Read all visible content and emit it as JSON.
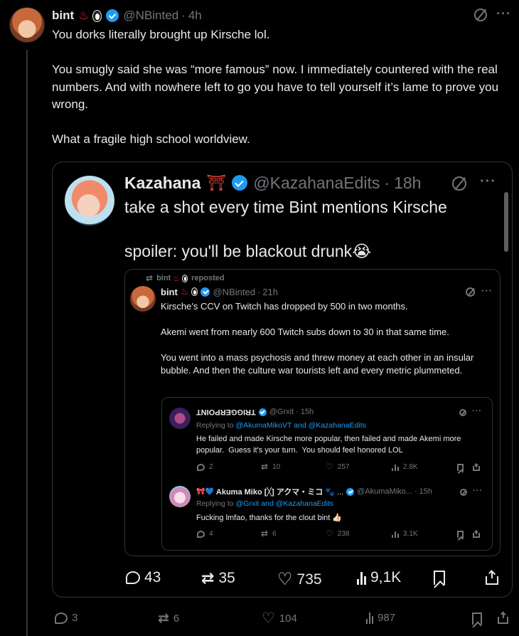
{
  "post": {
    "name": "bint",
    "handle": "@NBinted",
    "sep": "·",
    "time": "4h",
    "text": "You dorks literally brought up Kirsche lol.\n\nYou smugly said she was “more famous” now. I immediately countered with the real numbers. And with nowhere left to go you have to tell yourself it’s lame to prove you wrong.\n\nWhat a fragile high school worldview.",
    "replies": "3",
    "reposts": "6",
    "likes": "104",
    "views": "987"
  },
  "quote": {
    "name": "Kazahana",
    "name_emoji": "⛩",
    "handle": "@KazahanaEdits",
    "sep": "·",
    "time": "18h",
    "text": "take a shot every time Bint mentions Kirsche\n\nspoiler: you'll be blackout drunk",
    "text_emoji": "😭",
    "replies": "43",
    "reposts": "35",
    "likes": "735",
    "views": "9,1K"
  },
  "repost": {
    "header": "bint",
    "reposted_label": "reposted",
    "name": "bint",
    "handle": "@NBinted",
    "sep": "·",
    "time": "21h",
    "text": "Kirsche's CCV on Twitch has dropped by 500 in two months.\n\nAkemi went from nearly 600 Twitch subs down to 30 in that same time.\n\nYou went into a mass psychosis and threw money at each other in an insular bubble. And then the culture war tourists left and every metric plummeted."
  },
  "reply1": {
    "name": "TRIGGERPOINT",
    "handle": "@Grxit",
    "sep": "·",
    "time": "15h",
    "replying_prefix": "Replying to",
    "replying_to": "@AkumaMikoVT and @KazahanaEdits",
    "text": "He failed and made Kirsche more popular, then failed and made Akemi more popular.  Guess it's your turn.  You should feel honored LOL",
    "replies": "2",
    "reposts": "10",
    "likes": "257",
    "views": "2.8K"
  },
  "reply2": {
    "name_prefix": "🎀💙",
    "name": "Akuma Miko [╳] アクマ・ミコ",
    "name_suffix": "🐾 ...",
    "handle": "@AkumaMiko...",
    "sep": "·",
    "time": "15h",
    "replying_prefix": "Replying to",
    "replying_to": "@Grxit and @KazahanaEdits",
    "text": "Fucking lmfao, thanks for the clout bint",
    "text_emoji": "👍🏻",
    "replies": "4",
    "reposts": "6",
    "likes": "238",
    "views": "3.1K"
  },
  "colors": {
    "background": "#000000",
    "text": "#e7e9ea",
    "muted": "#71767b",
    "link": "#1d9bf0",
    "verified": "#1d9bf0",
    "border": "#2f3336"
  },
  "icons": [
    "verified-badge-icon",
    "hot-springs-icon",
    "penguin-icon",
    "grok-icon",
    "more-icon",
    "reply-icon",
    "repost-icon",
    "like-icon",
    "views-icon",
    "bookmark-icon",
    "share-icon",
    "torii-icon"
  ]
}
